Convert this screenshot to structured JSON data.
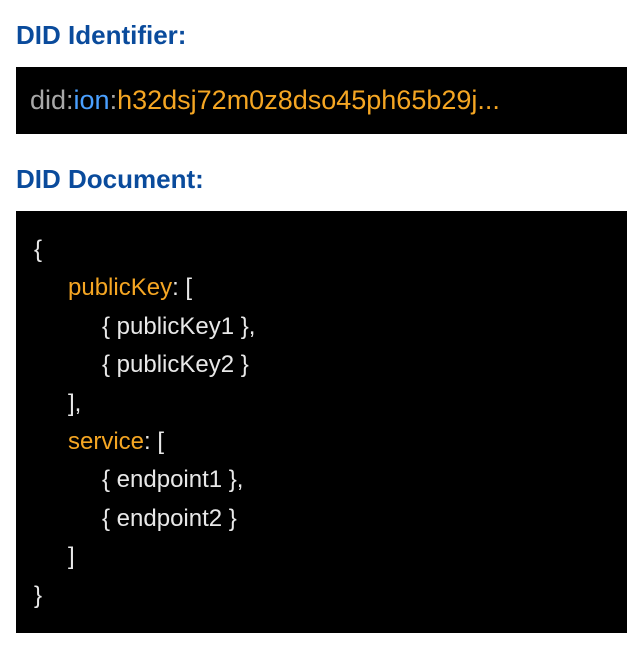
{
  "headings": {
    "identifier": "DID Identifier:",
    "document": "DID Document:"
  },
  "identifier": {
    "scheme": "did",
    "method": "ion",
    "id": "h32dsj72m0z8dso45ph65b29j...",
    "sep": ":"
  },
  "document": {
    "open": "{",
    "close": "}",
    "arrOpen": "[",
    "arrClose": "]",
    "arrCloseComma": "],",
    "keySep": ": ",
    "keys": {
      "publicKey": "publicKey",
      "service": "service"
    },
    "publicKeys": {
      "item1": "{ publicKey1 },",
      "item2": "{ publicKey2 }"
    },
    "services": {
      "item1": "{ endpoint1 },",
      "item2": "{ endpoint2 }"
    }
  }
}
